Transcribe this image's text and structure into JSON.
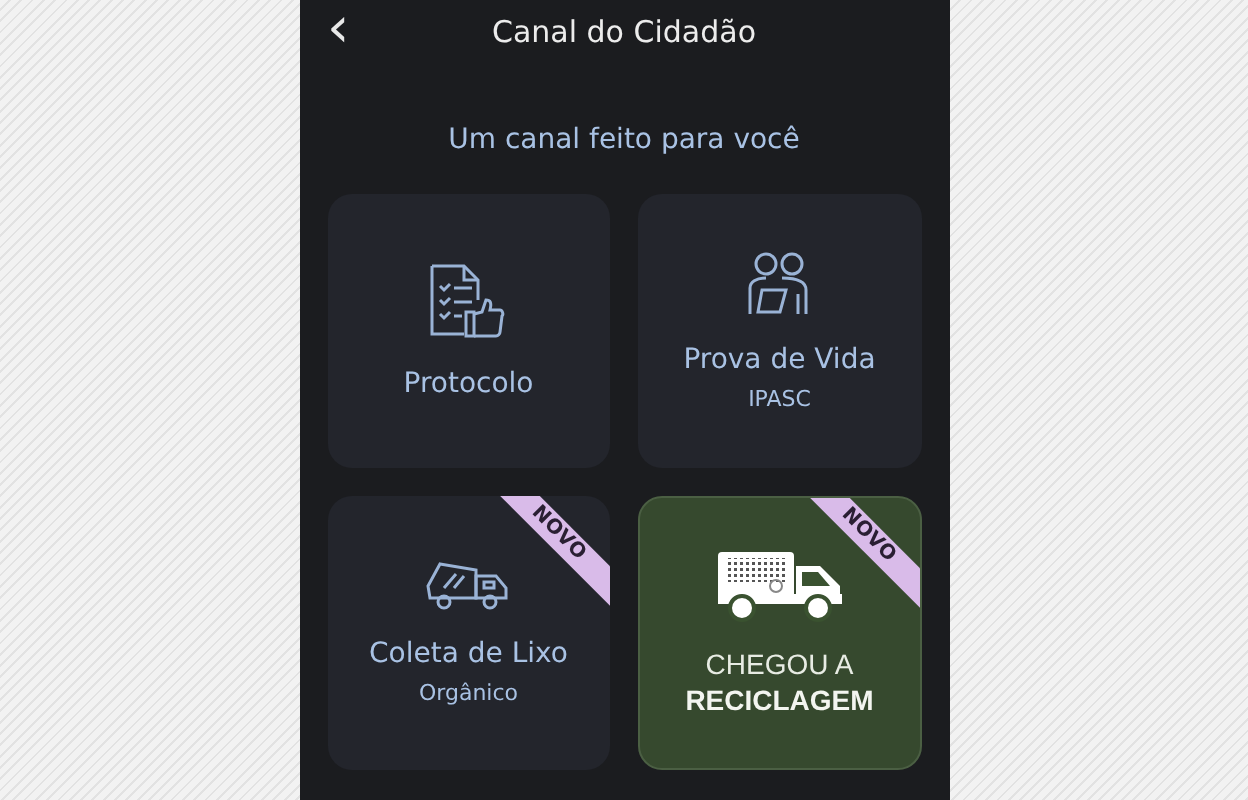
{
  "header": {
    "back": "‹",
    "title": "Canal do Cidadão"
  },
  "subtitle": "Um canal feito para você",
  "cards": [
    {
      "kind": "service",
      "title": "Protocolo"
    },
    {
      "kind": "service",
      "title": "Prova de Vida",
      "subtitle": "IPASC"
    },
    {
      "kind": "service",
      "title": "Coleta de Lixo",
      "subtitle": "Orgânico",
      "badge": "NOVO"
    },
    {
      "kind": "promo",
      "title": "CHEGOU A",
      "subtitle": "RECICLAGEM",
      "badge": "NOVO"
    }
  ]
}
